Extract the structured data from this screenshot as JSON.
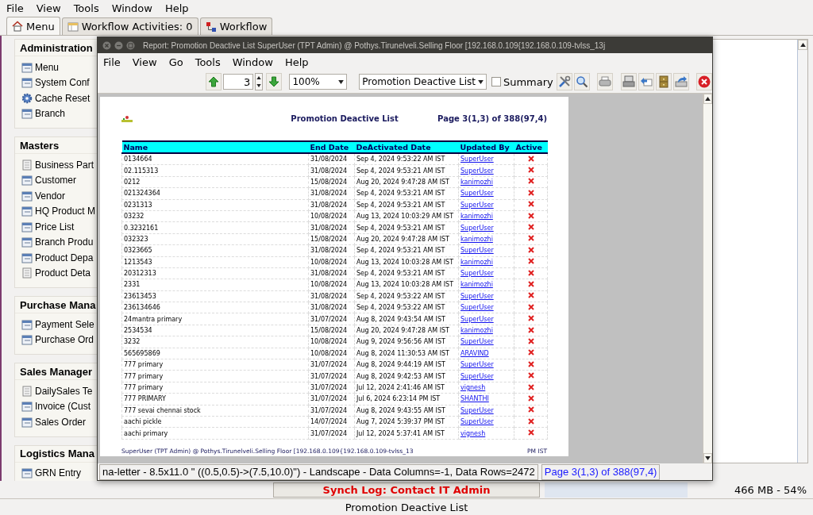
{
  "menu_bar": [
    "File",
    "View",
    "Tools",
    "Window",
    "Help"
  ],
  "tabs": [
    {
      "label": "Menu",
      "selected": true
    },
    {
      "label": "Workflow Activities: 0",
      "selected": false
    },
    {
      "label": "Workflow",
      "selected": false
    }
  ],
  "sidebar": [
    {
      "title": "Administration",
      "items": [
        {
          "label": "Menu",
          "kind": "window"
        },
        {
          "label": "System Conf",
          "kind": "window"
        },
        {
          "label": "Cache Reset",
          "kind": "process"
        },
        {
          "label": "Branch",
          "kind": "window"
        }
      ]
    },
    {
      "title": "Masters",
      "items": [
        {
          "label": "Business Part",
          "kind": "report"
        },
        {
          "label": "Customer",
          "kind": "window"
        },
        {
          "label": "Vendor",
          "kind": "window"
        },
        {
          "label": "HQ Product M",
          "kind": "window"
        },
        {
          "label": "Price List",
          "kind": "window"
        },
        {
          "label": "Branch Produ",
          "kind": "window"
        },
        {
          "label": "Product Depa",
          "kind": "window"
        },
        {
          "label": "Product Deta",
          "kind": "report"
        }
      ]
    },
    {
      "title": "Purchase Mana",
      "items": [
        {
          "label": "Payment Sele",
          "kind": "window"
        },
        {
          "label": "Purchase Ord",
          "kind": "window"
        }
      ]
    },
    {
      "title": "Sales Manager",
      "items": [
        {
          "label": "DailySales Te",
          "kind": "report"
        },
        {
          "label": "Invoice (Cust",
          "kind": "window"
        },
        {
          "label": "Sales Order",
          "kind": "window"
        }
      ]
    },
    {
      "title": "Logistics Mana",
      "items": [
        {
          "label": "GRN Entry",
          "kind": "window"
        }
      ]
    }
  ],
  "report_window": {
    "title": "Report: Promotion Deactive List SuperUser (TPT Admin) @ Pothys.Tirunelveli.Selling Floor [192.168.0.109{192.168.0.109-tvlss_13j",
    "menu_bar": [
      "File",
      "View",
      "Go",
      "Tools",
      "Window",
      "Help"
    ],
    "toolbar": {
      "page": "3",
      "zoom": "100%",
      "report": "Promotion Deactive List",
      "summary": {
        "label": "Summary",
        "checked": false
      }
    },
    "page": {
      "title": "Promotion Deactive List",
      "page_info": "Page 3(1,3) of 388(97,4)",
      "columns": [
        "Name",
        "End Date",
        "DeActivated Date",
        "Updated By",
        "Active"
      ],
      "rows": [
        {
          "name": "0134664",
          "end_date": "31/08/2024",
          "deactivated": "Sep 4, 2024 9:53:22 AM IST",
          "updated_by": "SuperUser",
          "active": false
        },
        {
          "name": "02.115313",
          "end_date": "31/08/2024",
          "deactivated": "Sep 4, 2024 9:53:21 AM IST",
          "updated_by": "SuperUser",
          "active": false
        },
        {
          "name": "0212",
          "end_date": "15/08/2024",
          "deactivated": "Aug 20, 2024 9:47:28 AM IST",
          "updated_by": "kanimozhi",
          "active": false
        },
        {
          "name": "021324364",
          "end_date": "31/08/2024",
          "deactivated": "Sep 4, 2024 9:53:21 AM IST",
          "updated_by": "SuperUser",
          "active": false
        },
        {
          "name": "0231313",
          "end_date": "31/08/2024",
          "deactivated": "Sep 4, 2024 9:53:21 AM IST",
          "updated_by": "SuperUser",
          "active": false
        },
        {
          "name": "03232",
          "end_date": "10/08/2024",
          "deactivated": "Aug 13, 2024 10:03:29 AM IST",
          "updated_by": "kanimozhi",
          "active": false
        },
        {
          "name": "0.3232161",
          "end_date": "31/08/2024",
          "deactivated": "Sep 4, 2024 9:53:21 AM IST",
          "updated_by": "SuperUser",
          "active": false
        },
        {
          "name": "032323",
          "end_date": "15/08/2024",
          "deactivated": "Aug 20, 2024 9:47:28 AM IST",
          "updated_by": "kanimozhi",
          "active": false
        },
        {
          "name": "0323665",
          "end_date": "31/08/2024",
          "deactivated": "Sep 4, 2024 9:53:21 AM IST",
          "updated_by": "SuperUser",
          "active": false
        },
        {
          "name": "1213543",
          "end_date": "10/08/2024",
          "deactivated": "Aug 13, 2024 10:03:28 AM IST",
          "updated_by": "kanimozhi",
          "active": false
        },
        {
          "name": "20312313",
          "end_date": "31/08/2024",
          "deactivated": "Sep 4, 2024 9:53:21 AM IST",
          "updated_by": "SuperUser",
          "active": false
        },
        {
          "name": "2331",
          "end_date": "10/08/2024",
          "deactivated": "Aug 13, 2024 10:03:28 AM IST",
          "updated_by": "kanimozhi",
          "active": false
        },
        {
          "name": "23613453",
          "end_date": "31/08/2024",
          "deactivated": "Sep 4, 2024 9:53:22 AM IST",
          "updated_by": "SuperUser",
          "active": false
        },
        {
          "name": "236134646",
          "end_date": "31/08/2024",
          "deactivated": "Sep 4, 2024 9:53:22 AM IST",
          "updated_by": "SuperUser",
          "active": false
        },
        {
          "name": "24mantra primary",
          "end_date": "31/07/2024",
          "deactivated": "Aug 8, 2024 9:43:54 AM IST",
          "updated_by": "SuperUser",
          "active": false
        },
        {
          "name": "2534534",
          "end_date": "15/08/2024",
          "deactivated": "Aug 20, 2024 9:47:28 AM IST",
          "updated_by": "kanimozhi",
          "active": false
        },
        {
          "name": "3232",
          "end_date": "10/08/2024",
          "deactivated": "Aug 9, 2024 9:56:56 AM IST",
          "updated_by": "SuperUser",
          "active": false
        },
        {
          "name": "565695869",
          "end_date": "10/08/2024",
          "deactivated": "Aug 8, 2024 11:30:53 AM IST",
          "updated_by": "ARAVIND",
          "active": false
        },
        {
          "name": "777 primary",
          "end_date": "31/07/2024",
          "deactivated": "Aug 8, 2024 9:44:19 AM IST",
          "updated_by": "SuperUser",
          "active": false
        },
        {
          "name": "777 primary",
          "end_date": "31/07/2024",
          "deactivated": "Aug 8, 2024 9:42:53 AM IST",
          "updated_by": "SuperUser",
          "active": false
        },
        {
          "name": "777 primary",
          "end_date": "31/07/2024",
          "deactivated": "Jul 12, 2024 2:41:46 AM IST",
          "updated_by": "vignesh",
          "active": false
        },
        {
          "name": "777 PRIMARY",
          "end_date": "31/07/2024",
          "deactivated": "Jul 6, 2024 6:23:14 PM IST",
          "updated_by": "SHANTHI",
          "active": false
        },
        {
          "name": "777 sevai chennai stock",
          "end_date": "31/07/2024",
          "deactivated": "Aug 8, 2024 9:43:55 AM IST",
          "updated_by": "SuperUser",
          "active": false
        },
        {
          "name": "aachi pickle",
          "end_date": "14/07/2024",
          "deactivated": "Aug 7, 2024 5:39:37 PM IST",
          "updated_by": "SuperUser",
          "active": false
        },
        {
          "name": "aachi primary",
          "end_date": "31/07/2024",
          "deactivated": "Jul 12, 2024 5:37:41 AM IST",
          "updated_by": "vignesh",
          "active": false
        }
      ],
      "footer_left": "SuperUser (TPT Admin) @ Pothys.Tirunelveli.Selling Floor [192.168.0.109{192.168.0.109-tvlss_13",
      "footer_right": "PM IST"
    },
    "status_left": "na-letter - 8.5x11.0 \" ((0.5,0.5)->(7.5,10.0)\") - Landscape - Data Columns=-1, Data Rows=2472",
    "status_right": "Page 3(1,3) of 388(97,4)"
  },
  "synch_log": "Synch Log: Contact IT Admin",
  "memory": {
    "text": "466 MB - 54%",
    "level": 0.54
  },
  "status_bar": "Promotion Deactive List"
}
